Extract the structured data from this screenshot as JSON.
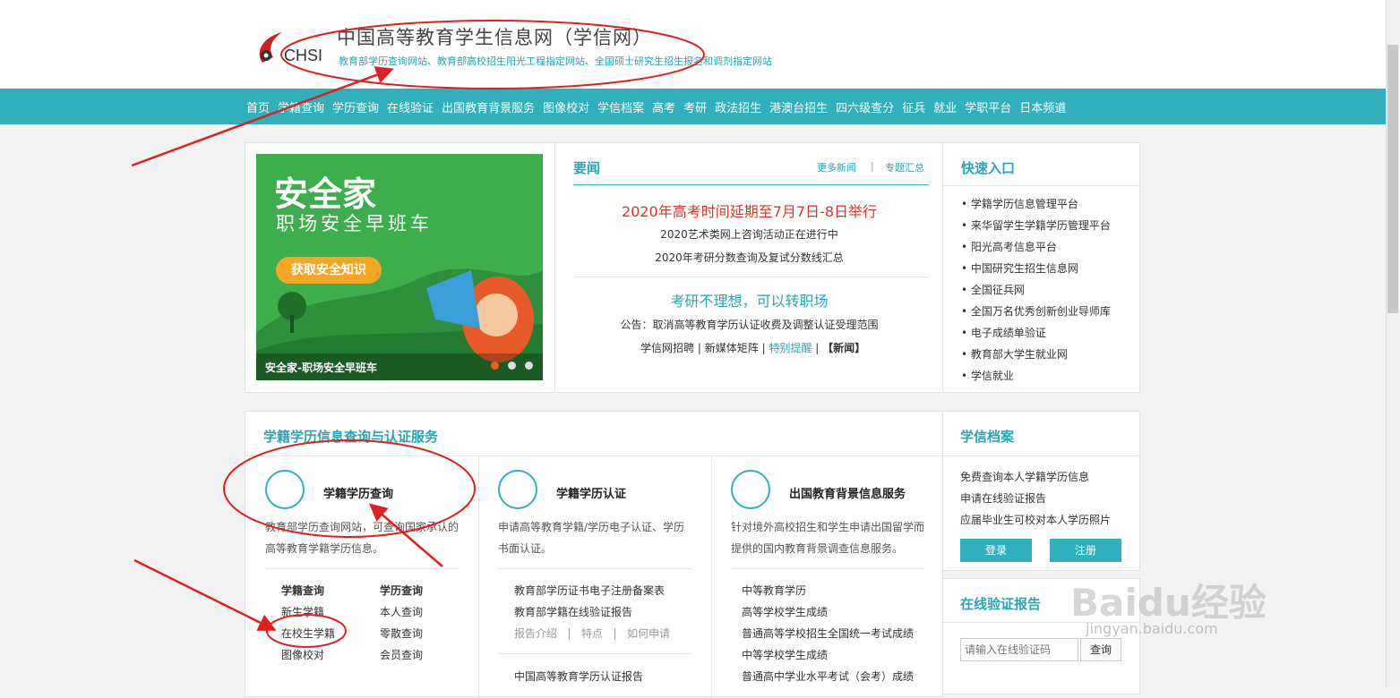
{
  "header": {
    "logo_text": "CHSI",
    "title": "中国高等教育学生信息网（学信网）",
    "subtitle": "教育部学历查询网站、教育部高校招生阳光工程指定网站、全国硕士研究生招生报名和调剂指定网站"
  },
  "nav": [
    "首页",
    "学籍查询",
    "学历查询",
    "在线验证",
    "出国教育背景服务",
    "图像校对",
    "学信档案",
    "高考",
    "考研",
    "政法招生",
    "港澳台招生",
    "四六级查分",
    "征兵",
    "就业",
    "学职平台",
    "日本频道"
  ],
  "banner": {
    "brand": "安全家",
    "tagline": "职场安全早班车",
    "button": "获取安全知识",
    "caption": "安全家-职场安全早班车"
  },
  "news": {
    "title": "要闻",
    "more": "更多新闻",
    "separator": "|",
    "topics": "专题汇总",
    "headline": "2020年高考时间延期至7月7日-8日举行",
    "lines": [
      "2020艺术类网上咨询活动正在进行中",
      "2020年考研分数查询及复试分数线汇总"
    ],
    "headline2": "考研不理想，可以转职场",
    "notice": "公告：取消高等教育学历认证收费及调整认证受理范围",
    "links": [
      "学信网招聘",
      "|",
      "新媒体矩阵",
      "|",
      "特别提醒",
      "|",
      "【新闻】"
    ]
  },
  "quick": {
    "title": "快速入口",
    "items": [
      "学籍学历信息管理平台",
      "来华留学生学籍学历管理平台",
      "阳光高考信息平台",
      "中国研究生招生信息网",
      "全国征兵网",
      "全国万名优秀创新创业导师库",
      "电子成绩单验证",
      "教育部大学生就业网",
      "学信就业"
    ]
  },
  "services": {
    "title": "学籍学历信息查询与认证服务",
    "cards": [
      {
        "title": "学籍学历查询",
        "desc": "教育部学历查询网站，可查询国家承认的高等教育学籍学历信息。"
      },
      {
        "title": "学籍学历认证",
        "desc": "申请高等教育学籍/学历电子认证、学历书面认证。"
      },
      {
        "title": "出国教育背景信息服务",
        "desc": "针对境外高校招生和学生申请出国留学而提供的国内教育背景调查信息服务。"
      }
    ],
    "col1_head": [
      "学籍查询",
      "学历查询"
    ],
    "col1_rows": [
      [
        "新生学籍",
        "本人查询"
      ],
      [
        "在校生学籍",
        "零散查询"
      ],
      [
        "图像校对",
        "会员查询"
      ]
    ],
    "col2_items": [
      "教育部学历证书电子注册备案表",
      "教育部学籍在线验证报告"
    ],
    "col2_links": [
      "报告介绍",
      "|",
      "特点",
      "|",
      "如何申请"
    ],
    "col2_item3": "中国高等教育学历认证报告",
    "col3_items": [
      "中等教育学历",
      "高等学校学生成绩",
      "普通高等学校招生全国统一考试成绩",
      "中等学校学生成绩",
      "普通高中学业水平考试（会考）成绩"
    ]
  },
  "archive": {
    "title": "学信档案",
    "items": [
      "免费查询本人学籍学历信息",
      "申请在线验证报告",
      "应届毕业生可校对本人学历照片"
    ],
    "login": "登录",
    "register": "注册"
  },
  "verify": {
    "title": "在线验证报告",
    "placeholder": "请输入在线验证码",
    "button": "查询"
  },
  "watermark": {
    "brand": "Baidu经验",
    "url": "jingyan.baidu.com"
  },
  "colors": {
    "accent": "#2fb0ba",
    "headline": "#d9362b",
    "annotation": "#e02020"
  }
}
